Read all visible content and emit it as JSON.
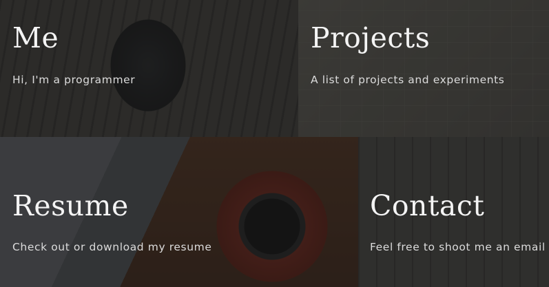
{
  "tiles": {
    "me": {
      "title": "Me",
      "description": "Hi, I'm a programmer"
    },
    "projects": {
      "title": "Projects",
      "description": "A list of projects and experiments"
    },
    "resume": {
      "title": "Resume",
      "description": "Check out or download my resume"
    },
    "contact": {
      "title": "Contact",
      "description": "Feel free to shoot me an email"
    }
  },
  "colors": {
    "text": "#f4f4f4",
    "overlay": "#141414"
  }
}
